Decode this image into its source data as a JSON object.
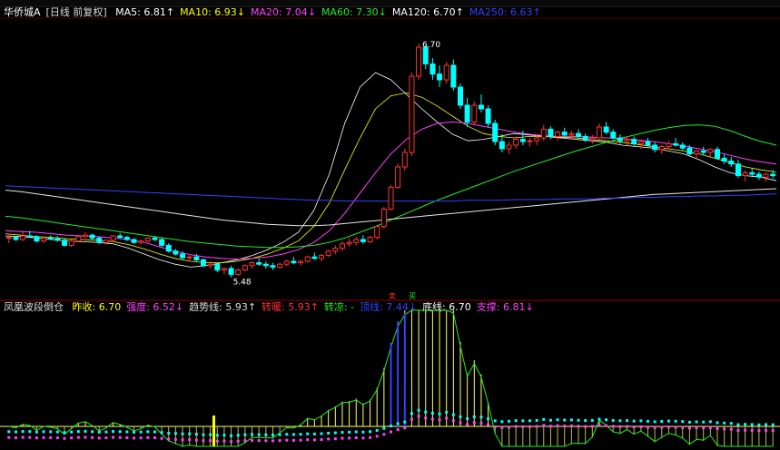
{
  "header": {
    "stock_name": "华侨城A",
    "period_label": "[日线 前复权]"
  },
  "ma_legend": [
    {
      "label": "MA5",
      "value": "6.81",
      "arrow": "↑",
      "color": "#ffffff"
    },
    {
      "label": "MA10",
      "value": "6.93",
      "arrow": "↓",
      "color": "#ffff00"
    },
    {
      "label": "MA20",
      "value": "7.04",
      "arrow": "↓",
      "color": "#ff40ff"
    },
    {
      "label": "MA60",
      "value": "7.30",
      "arrow": "↓",
      "color": "#22ee22"
    },
    {
      "label": "MA120",
      "value": "6.70",
      "arrow": "↑",
      "color": "#ffffff"
    },
    {
      "label": "MA250",
      "value": "6.63",
      "arrow": "↑",
      "color": "#3344ff"
    }
  ],
  "indicator": {
    "name": "凤凰波段倒仓",
    "items": [
      {
        "label": "昨收:",
        "value": "6.70",
        "arrow": "",
        "color": "#ffff00"
      },
      {
        "label": "强度:",
        "value": "6.52",
        "arrow": "↓",
        "color": "#ff40ff"
      },
      {
        "label": "趋势线:",
        "value": "5.93",
        "arrow": "↑",
        "color": "#dddddd"
      },
      {
        "label": "转暖:",
        "value": "5.93",
        "arrow": "↑",
        "color": "#ff3333"
      },
      {
        "label": "转凉:",
        "value": "-",
        "arrow": "",
        "color": "#22ee22"
      },
      {
        "label": "顶线:",
        "value": "7.44",
        "arrow": "↓",
        "color": "#3344ff"
      },
      {
        "label": "底线:",
        "value": "6.70",
        "arrow": "",
        "color": "#ffffff"
      },
      {
        "label": "支撑:",
        "value": "6.81",
        "arrow": "↓",
        "color": "#ff40ff"
      }
    ]
  },
  "annotations": {
    "high_label": "6.70",
    "low_label": "5.48",
    "signal_chars": [
      "卖",
      "买"
    ]
  },
  "colors": {
    "up": "#ff3333",
    "down": "#00ffff",
    "background": "#000000"
  },
  "chart_data": {
    "type": "candlestick",
    "y_range": [
      5.3,
      9.0
    ],
    "candles": [
      [
        6.02,
        6.08,
        5.95,
        6.03
      ],
      [
        6.03,
        6.05,
        5.98,
        6.0
      ],
      [
        6.0,
        6.1,
        5.98,
        6.05
      ],
      [
        6.05,
        6.12,
        6.02,
        6.04
      ],
      [
        6.04,
        6.06,
        5.96,
        5.98
      ],
      [
        5.98,
        6.04,
        5.95,
        6.02
      ],
      [
        6.02,
        6.06,
        5.99,
        6.01
      ],
      [
        6.01,
        6.05,
        5.97,
        5.99
      ],
      [
        5.99,
        6.01,
        5.9,
        5.92
      ],
      [
        5.92,
        6.0,
        5.9,
        5.98
      ],
      [
        5.98,
        6.05,
        5.96,
        6.04
      ],
      [
        6.04,
        6.1,
        6.02,
        6.06
      ],
      [
        6.06,
        6.08,
        6.0,
        6.02
      ],
      [
        6.02,
        6.04,
        5.94,
        5.96
      ],
      [
        5.96,
        6.0,
        5.93,
        5.99
      ],
      [
        5.99,
        6.06,
        5.97,
        6.05
      ],
      [
        6.05,
        6.09,
        6.01,
        6.03
      ],
      [
        6.03,
        6.05,
        5.98,
        6.0
      ],
      [
        6.0,
        6.02,
        5.94,
        5.96
      ],
      [
        5.96,
        6.0,
        5.93,
        5.98
      ],
      [
        5.98,
        6.03,
        5.96,
        6.02
      ],
      [
        6.02,
        6.05,
        5.98,
        6.0
      ],
      [
        6.0,
        6.02,
        5.9,
        5.92
      ],
      [
        5.92,
        5.95,
        5.82,
        5.84
      ],
      [
        5.84,
        5.87,
        5.78,
        5.8
      ],
      [
        5.8,
        5.84,
        5.72,
        5.75
      ],
      [
        5.75,
        5.78,
        5.7,
        5.76
      ],
      [
        5.76,
        5.8,
        5.7,
        5.72
      ],
      [
        5.72,
        5.74,
        5.62,
        5.64
      ],
      [
        5.64,
        5.7,
        5.6,
        5.66
      ],
      [
        5.66,
        5.68,
        5.55,
        5.58
      ],
      [
        5.58,
        5.62,
        5.52,
        5.6
      ],
      [
        5.6,
        5.64,
        5.48,
        5.52
      ],
      [
        5.52,
        5.6,
        5.5,
        5.58
      ],
      [
        5.58,
        5.66,
        5.56,
        5.64
      ],
      [
        5.64,
        5.7,
        5.6,
        5.68
      ],
      [
        5.68,
        5.74,
        5.64,
        5.66
      ],
      [
        5.66,
        5.7,
        5.6,
        5.64
      ],
      [
        5.64,
        5.68,
        5.58,
        5.62
      ],
      [
        5.62,
        5.68,
        5.6,
        5.66
      ],
      [
        5.66,
        5.72,
        5.63,
        5.7
      ],
      [
        5.7,
        5.76,
        5.66,
        5.68
      ],
      [
        5.68,
        5.72,
        5.64,
        5.7
      ],
      [
        5.7,
        5.78,
        5.68,
        5.76
      ],
      [
        5.76,
        5.82,
        5.72,
        5.74
      ],
      [
        5.74,
        5.8,
        5.7,
        5.78
      ],
      [
        5.78,
        5.86,
        5.76,
        5.84
      ],
      [
        5.84,
        5.92,
        5.8,
        5.88
      ],
      [
        5.88,
        5.98,
        5.84,
        5.94
      ],
      [
        5.94,
        6.02,
        5.9,
        5.96
      ],
      [
        5.96,
        6.04,
        5.92,
        6.0
      ],
      [
        6.0,
        6.06,
        5.94,
        5.97
      ],
      [
        5.97,
        6.05,
        5.95,
        6.03
      ],
      [
        6.03,
        6.2,
        6.0,
        6.18
      ],
      [
        6.18,
        6.45,
        6.15,
        6.42
      ],
      [
        6.42,
        6.75,
        6.4,
        6.72
      ],
      [
        6.72,
        7.05,
        6.7,
        7.0
      ],
      [
        7.0,
        7.25,
        6.95,
        7.2
      ],
      [
        7.2,
        8.3,
        7.15,
        8.25
      ],
      [
        8.25,
        8.7,
        8.2,
        8.65
      ],
      [
        8.65,
        8.68,
        8.35,
        8.42
      ],
      [
        8.42,
        8.5,
        8.2,
        8.28
      ],
      [
        8.28,
        8.4,
        8.1,
        8.2
      ],
      [
        8.2,
        8.45,
        8.15,
        8.4
      ],
      [
        8.4,
        8.48,
        8.05,
        8.1
      ],
      [
        8.1,
        8.15,
        7.8,
        7.85
      ],
      [
        7.85,
        7.95,
        7.55,
        7.62
      ],
      [
        7.62,
        7.9,
        7.58,
        7.85
      ],
      [
        7.85,
        8.0,
        7.75,
        7.8
      ],
      [
        7.8,
        7.85,
        7.55,
        7.6
      ],
      [
        7.6,
        7.65,
        7.3,
        7.35
      ],
      [
        7.35,
        7.45,
        7.2,
        7.25
      ],
      [
        7.25,
        7.35,
        7.18,
        7.3
      ],
      [
        7.3,
        7.42,
        7.25,
        7.38
      ],
      [
        7.38,
        7.5,
        7.3,
        7.35
      ],
      [
        7.35,
        7.4,
        7.28,
        7.36
      ],
      [
        7.36,
        7.45,
        7.3,
        7.4
      ],
      [
        7.4,
        7.58,
        7.36,
        7.52
      ],
      [
        7.52,
        7.56,
        7.38,
        7.42
      ],
      [
        7.42,
        7.5,
        7.36,
        7.48
      ],
      [
        7.48,
        7.54,
        7.4,
        7.44
      ],
      [
        7.44,
        7.5,
        7.38,
        7.46
      ],
      [
        7.46,
        7.52,
        7.4,
        7.42
      ],
      [
        7.42,
        7.46,
        7.34,
        7.38
      ],
      [
        7.38,
        7.44,
        7.32,
        7.4
      ],
      [
        7.4,
        7.6,
        7.38,
        7.55
      ],
      [
        7.55,
        7.62,
        7.45,
        7.48
      ],
      [
        7.48,
        7.52,
        7.38,
        7.4
      ],
      [
        7.4,
        7.45,
        7.32,
        7.36
      ],
      [
        7.36,
        7.42,
        7.3,
        7.38
      ],
      [
        7.38,
        7.42,
        7.28,
        7.32
      ],
      [
        7.32,
        7.38,
        7.25,
        7.35
      ],
      [
        7.35,
        7.4,
        7.28,
        7.3
      ],
      [
        7.3,
        7.34,
        7.2,
        7.24
      ],
      [
        7.24,
        7.3,
        7.18,
        7.28
      ],
      [
        7.28,
        7.36,
        7.24,
        7.32
      ],
      [
        7.32,
        7.4,
        7.28,
        7.3
      ],
      [
        7.3,
        7.34,
        7.22,
        7.26
      ],
      [
        7.26,
        7.3,
        7.15,
        7.18
      ],
      [
        7.18,
        7.24,
        7.1,
        7.22
      ],
      [
        7.22,
        7.28,
        7.16,
        7.2
      ],
      [
        7.2,
        7.26,
        7.14,
        7.24
      ],
      [
        7.24,
        7.28,
        7.1,
        7.12
      ],
      [
        7.12,
        7.18,
        7.04,
        7.08
      ],
      [
        7.08,
        7.14,
        7.0,
        7.04
      ],
      [
        7.04,
        7.1,
        6.85,
        6.88
      ],
      [
        6.88,
        6.95,
        6.8,
        6.92
      ],
      [
        6.92,
        6.98,
        6.86,
        6.9
      ],
      [
        6.9,
        6.94,
        6.82,
        6.86
      ],
      [
        6.86,
        6.92,
        6.8,
        6.9
      ],
      [
        6.9,
        6.96,
        6.84,
        6.88
      ]
    ],
    "ma": {
      "MA5": [
        6.05,
        6.04,
        6.02,
        6.0,
        5.98,
        5.97,
        5.96,
        5.94,
        5.88,
        5.8,
        5.72,
        5.66,
        5.62,
        5.64,
        5.68,
        5.72,
        5.78,
        5.86,
        5.96,
        6.1,
        6.4,
        6.9,
        7.6,
        8.1,
        8.3,
        8.2,
        8.0,
        7.8,
        7.62,
        7.45,
        7.36,
        7.38,
        7.42,
        7.46,
        7.44,
        7.42,
        7.4,
        7.38,
        7.36,
        7.34,
        7.3,
        7.28,
        7.26,
        7.22,
        7.18,
        7.1,
        7.0,
        6.92,
        6.88,
        6.86,
        6.81
      ],
      "MA10": [
        6.08,
        6.06,
        6.04,
        6.03,
        6.01,
        6.0,
        5.99,
        5.97,
        5.93,
        5.87,
        5.8,
        5.74,
        5.7,
        5.68,
        5.68,
        5.7,
        5.74,
        5.8,
        5.88,
        5.98,
        6.18,
        6.5,
        6.96,
        7.4,
        7.8,
        7.98,
        8.02,
        7.96,
        7.84,
        7.7,
        7.56,
        7.46,
        7.42,
        7.4,
        7.42,
        7.42,
        7.41,
        7.4,
        7.38,
        7.36,
        7.34,
        7.31,
        7.28,
        7.25,
        7.22,
        7.18,
        7.12,
        7.06,
        7.0,
        6.96,
        6.93
      ],
      "MA20": [
        6.12,
        6.11,
        6.1,
        6.08,
        6.06,
        6.05,
        6.04,
        6.02,
        6.0,
        5.96,
        5.9,
        5.84,
        5.79,
        5.76,
        5.74,
        5.73,
        5.74,
        5.76,
        5.8,
        5.86,
        5.96,
        6.12,
        6.36,
        6.64,
        6.92,
        7.18,
        7.38,
        7.52,
        7.6,
        7.62,
        7.6,
        7.56,
        7.52,
        7.48,
        7.45,
        7.43,
        7.42,
        7.42,
        7.41,
        7.4,
        7.39,
        7.37,
        7.35,
        7.32,
        7.29,
        7.25,
        7.21,
        7.16,
        7.11,
        7.07,
        7.04
      ],
      "MA60": [
        6.32,
        6.3,
        6.27,
        6.24,
        6.21,
        6.18,
        6.15,
        6.12,
        6.09,
        6.06,
        6.03,
        6.0,
        5.97,
        5.95,
        5.93,
        5.91,
        5.9,
        5.89,
        5.89,
        5.9,
        5.92,
        5.96,
        6.02,
        6.1,
        6.18,
        6.27,
        6.36,
        6.45,
        6.54,
        6.62,
        6.7,
        6.78,
        6.86,
        6.94,
        7.01,
        7.08,
        7.15,
        7.22,
        7.28,
        7.34,
        7.4,
        7.45,
        7.5,
        7.54,
        7.57,
        7.58,
        7.56,
        7.5,
        7.42,
        7.35,
        7.3
      ],
      "MA120": [
        6.68,
        6.66,
        6.63,
        6.6,
        6.57,
        6.54,
        6.51,
        6.48,
        6.45,
        6.42,
        6.39,
        6.36,
        6.33,
        6.3,
        6.27,
        6.25,
        6.23,
        6.21,
        6.2,
        6.19,
        6.19,
        6.2,
        6.22,
        6.24,
        6.26,
        6.28,
        6.3,
        6.32,
        6.34,
        6.36,
        6.38,
        6.4,
        6.42,
        6.44,
        6.46,
        6.48,
        6.5,
        6.52,
        6.54,
        6.56,
        6.58,
        6.6,
        6.62,
        6.63,
        6.64,
        6.65,
        6.66,
        6.67,
        6.68,
        6.69,
        6.7
      ],
      "MA250": [
        6.74,
        6.73,
        6.72,
        6.71,
        6.7,
        6.69,
        6.68,
        6.67,
        6.66,
        6.65,
        6.64,
        6.63,
        6.62,
        6.61,
        6.6,
        6.59,
        6.58,
        6.57,
        6.56,
        6.55,
        6.54,
        6.54,
        6.53,
        6.53,
        6.53,
        6.53,
        6.53,
        6.53,
        6.53,
        6.53,
        6.54,
        6.54,
        6.54,
        6.55,
        6.55,
        6.55,
        6.56,
        6.56,
        6.56,
        6.57,
        6.57,
        6.58,
        6.58,
        6.59,
        6.59,
        6.6,
        6.6,
        6.61,
        6.61,
        6.62,
        6.63
      ]
    }
  }
}
